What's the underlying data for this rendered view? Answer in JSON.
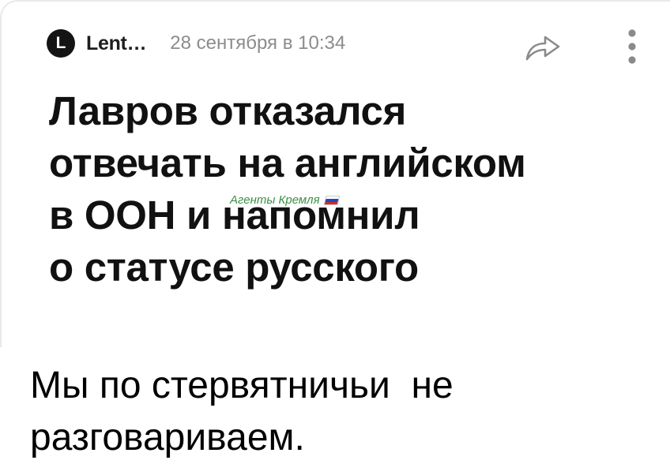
{
  "post": {
    "source_logo_letter": "L",
    "source_name": "Lent…",
    "date": "28 сентября в 10:34",
    "share_icon": "share-arrow-icon",
    "more_icon": "more-vertical-icon",
    "headline_lines": [
      "Лавров отказался",
      "отвечать на английском",
      "в ООН и напомнил",
      "о статусе русского"
    ]
  },
  "watermark": {
    "text": "Агенты Кремля",
    "flag_colors": [
      "#ffffff",
      "#1c49c4",
      "#d52b1e"
    ]
  },
  "caption": {
    "lines": [
      "Мы по стервятничьи  не",
      "разговариваем."
    ]
  },
  "colors": {
    "headline": "#111111",
    "date": "#8c8c8c",
    "logo_bg": "#141414",
    "watermark": "#3f8f46"
  }
}
